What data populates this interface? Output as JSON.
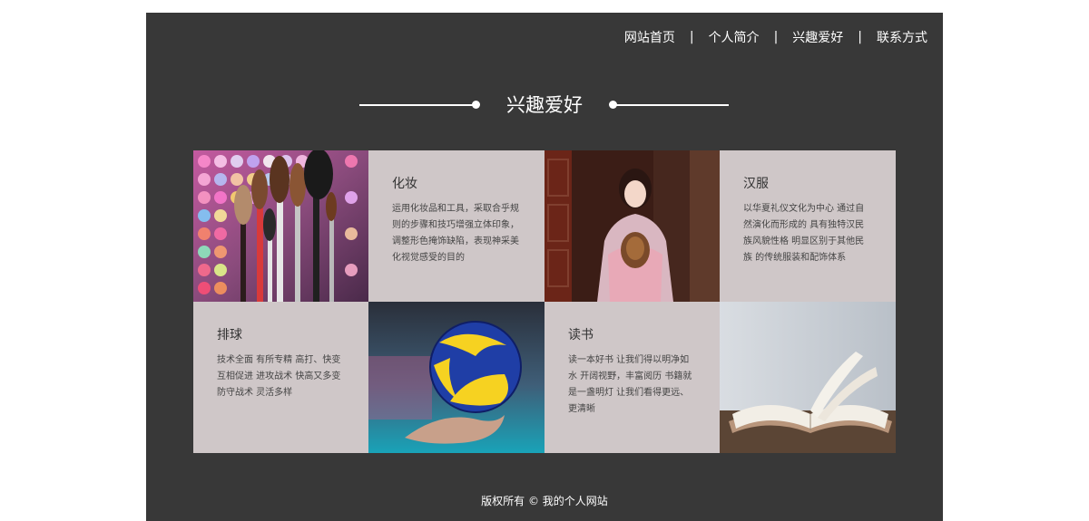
{
  "nav": {
    "items": [
      {
        "label": "网站首页"
      },
      {
        "label": "个人简介"
      },
      {
        "label": "兴趣爱好"
      },
      {
        "label": "联系方式"
      }
    ],
    "separator": "|"
  },
  "section": {
    "title": "兴趣爱好"
  },
  "cards": [
    {
      "title": "化妆",
      "text": "运用化妆品和工具，采取合乎规则的步骤和技巧增强立体印象，调整形色掩饰缺陷，表现神采美化视觉感受的目的"
    },
    {
      "title": "汉服",
      "text": "以华夏礼仪文化为中心 通过自然演化而形成的 具有独特汉民族风貌性格 明显区别于其他民族 的传统服装和配饰体系"
    },
    {
      "title": "排球",
      "text": "技术全面 有所专精 高打、快变 互相促进 进攻战术 快高又多变 防守战术 灵活多样"
    },
    {
      "title": "读书",
      "text": "读一本好书 让我们得以明净如水 开阔视野，丰富阅历 书籍就是一盏明灯 让我们看得更远、更清晰"
    }
  ],
  "images": {
    "makeup": "makeup-brushes-photo",
    "hanfu": "hanfu-woman-photo",
    "volleyball": "volleyball-photo",
    "book": "open-book-photo"
  },
  "footer": {
    "text": "版权所有 © 我的个人网站"
  },
  "colors": {
    "background": "#383838",
    "card": "#cfc7c8",
    "text": "#ffffff"
  }
}
